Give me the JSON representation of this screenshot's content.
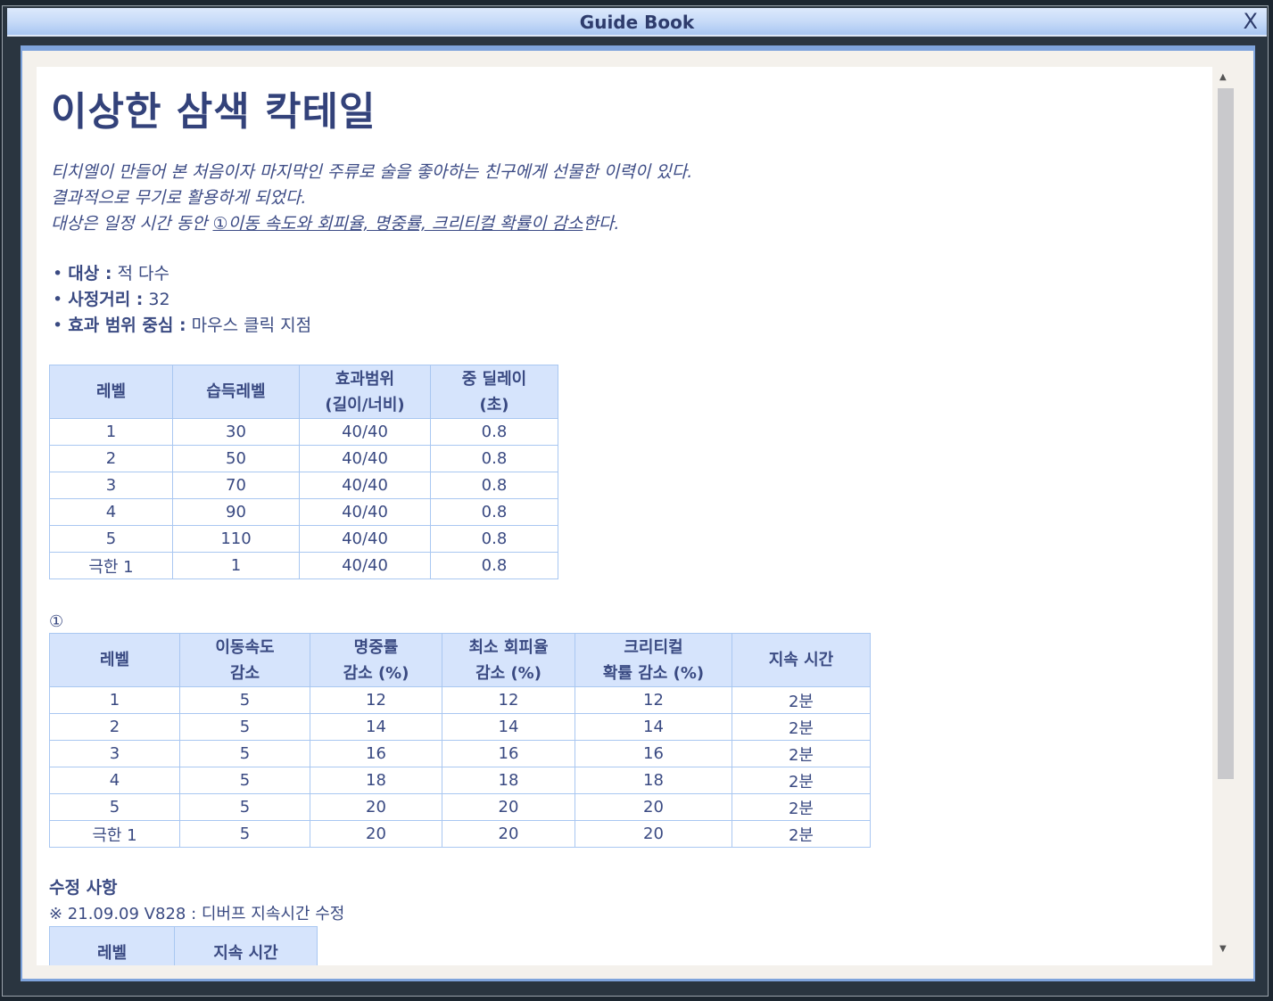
{
  "window": {
    "title": "Guide Book",
    "close_label": "X"
  },
  "page": {
    "title": "이상한 삼색 칵테일",
    "desc": [
      "티치엘이 만들어 본 처음이자 마지막인 주류로 술을 좋아하는 친구에게 선물한 이력이 있다.",
      "결과적으로 무기로 활용하게 되었다.",
      "대상은 일정 시간 동안 ",
      "①이동 속도와 회피율, 명중률, 크리티컬 확률이 감소",
      "한다."
    ],
    "bullets": [
      {
        "k": "대상 :",
        "v": " 적 다수"
      },
      {
        "k": "사정거리 :",
        "v": " 32"
      },
      {
        "k": "효과 범위 중심 :",
        "v": " 마우스 클릭 지점"
      }
    ],
    "table1": {
      "headers": [
        "레벨",
        "습득레벨",
        "효과범위\n(길이/너비)",
        "중 딜레이\n(초)"
      ],
      "rows": [
        [
          "1",
          "30",
          "40/40",
          "0.8"
        ],
        [
          "2",
          "50",
          "40/40",
          "0.8"
        ],
        [
          "3",
          "70",
          "40/40",
          "0.8"
        ],
        [
          "4",
          "90",
          "40/40",
          "0.8"
        ],
        [
          "5",
          "110",
          "40/40",
          "0.8"
        ],
        [
          "극한 1",
          "1",
          "40/40",
          "0.8"
        ]
      ]
    },
    "marker": "①",
    "table2": {
      "headers": [
        "레벨",
        "이동속도\n감소",
        "명중률\n감소 (%)",
        "최소 회피율\n감소 (%)",
        "크리티컬\n확률 감소 (%)",
        "지속 시간"
      ],
      "rows": [
        [
          "1",
          "5",
          "12",
          "12",
          "12",
          "2분"
        ],
        [
          "2",
          "5",
          "14",
          "14",
          "14",
          "2분"
        ],
        [
          "3",
          "5",
          "16",
          "16",
          "16",
          "2분"
        ],
        [
          "4",
          "5",
          "18",
          "18",
          "18",
          "2분"
        ],
        [
          "5",
          "5",
          "20",
          "20",
          "20",
          "2분"
        ],
        [
          "극한 1",
          "5",
          "20",
          "20",
          "20",
          "2분"
        ]
      ]
    },
    "changes_title": "수정 사항",
    "change_note": "※ 21.09.09 V828 : 디버프 지속시간 수정",
    "table3": {
      "headers": [
        "레벨",
        "지속 시간"
      ]
    }
  }
}
